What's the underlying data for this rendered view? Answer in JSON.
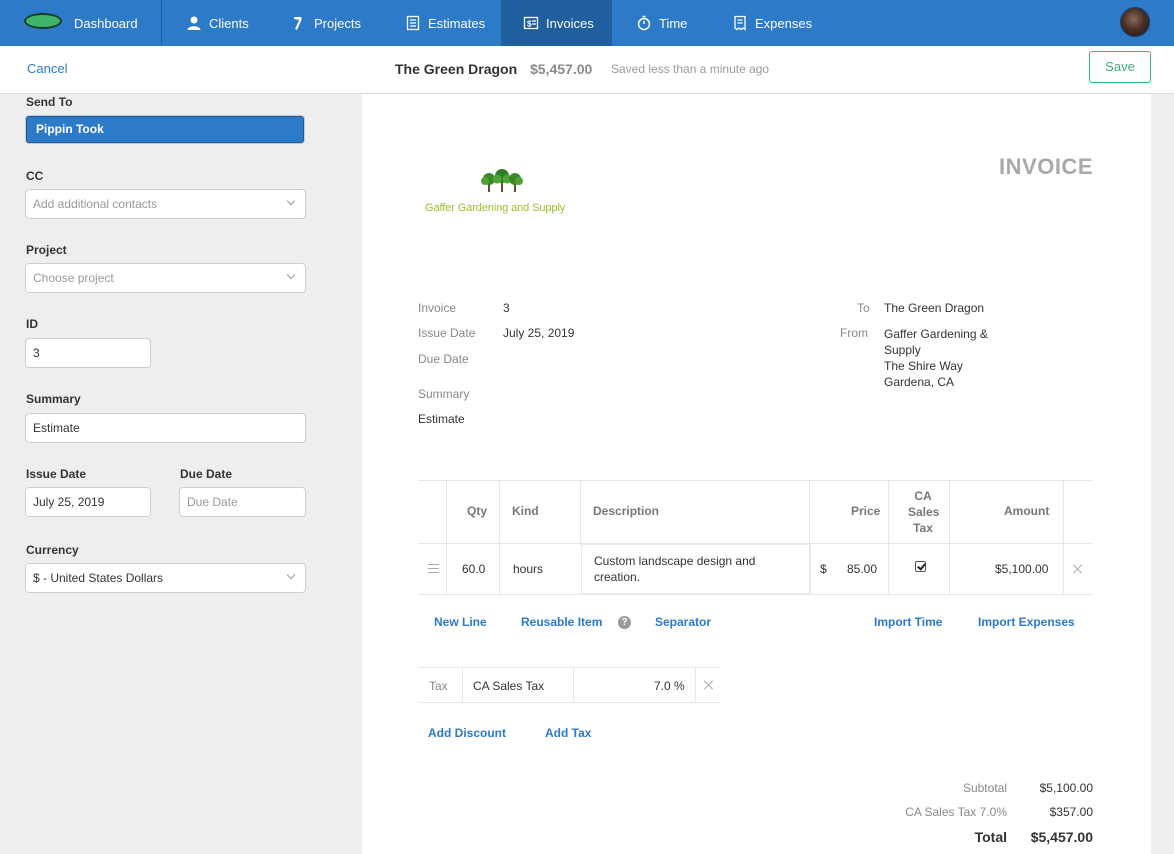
{
  "nav": {
    "dashboard": "Dashboard",
    "clients": "Clients",
    "projects": "Projects",
    "estimates": "Estimates",
    "invoices": "Invoices",
    "time": "Time",
    "expenses": "Expenses",
    "active": "Invoices",
    "accent": "#2d7ac9"
  },
  "header": {
    "cancel": "Cancel",
    "title": "The Green Dragon",
    "total": "$5,457.00",
    "saved": "Saved less than a minute ago",
    "save": "Save"
  },
  "sidebar": {
    "send_to_label": "Send To",
    "send_to_value": "Pippin Took",
    "cc_label": "CC",
    "cc_placeholder": "Add additional contacts",
    "project_label": "Project",
    "project_placeholder": "Choose project",
    "id_label": "ID",
    "id_value": "3",
    "summary_label": "Summary",
    "summary_value": "Estimate",
    "issue_date_label": "Issue Date",
    "issue_date_value": "July 25, 2019",
    "due_date_label": "Due Date",
    "due_date_placeholder": "Due Date",
    "currency_label": "Currency",
    "currency_value": "$ - United States Dollars"
  },
  "invoice": {
    "brand": "Gaffer Gardening and Supply",
    "heading": "INVOICE",
    "invoice_label": "Invoice",
    "invoice_value": "3",
    "issue_date_label": "Issue Date",
    "issue_date_value": "July 25, 2019",
    "due_date_label": "Due Date",
    "summary_label": "Summary",
    "summary_value": "Estimate",
    "to_label": "To",
    "to_value": "The Green Dragon",
    "from_label": "From",
    "from_lines": [
      "Gaffer Gardening &",
      "Supply",
      "The Shire Way",
      "Gardena, CA"
    ]
  },
  "line_items": {
    "columns": {
      "qty": "Qty",
      "kind": "Kind",
      "description": "Description",
      "price": "Price",
      "tax": [
        "CA",
        "Sales",
        "Tax"
      ],
      "amount": "Amount"
    },
    "rows": [
      {
        "qty": "60.0",
        "kind": "hours",
        "description": "Custom landscape design and creation.",
        "currency_symbol": "$",
        "price": "85.00",
        "taxed": true,
        "amount": "$5,100.00"
      }
    ],
    "actions": {
      "new_line": "New Line",
      "reusable_item": "Reusable Item",
      "separator": "Separator",
      "import_time": "Import Time",
      "import_expenses": "Import Expenses"
    }
  },
  "tax": {
    "label": "Tax",
    "name": "CA Sales Tax",
    "rate": "7.0 %"
  },
  "adjust": {
    "add_discount": "Add Discount",
    "add_tax": "Add Tax"
  },
  "totals": {
    "subtotal_label": "Subtotal",
    "subtotal_value": "$5,100.00",
    "tax_label": "CA Sales Tax 7.0%",
    "tax_value": "$357.00",
    "total_label": "Total",
    "total_value": "$5,457.00"
  }
}
